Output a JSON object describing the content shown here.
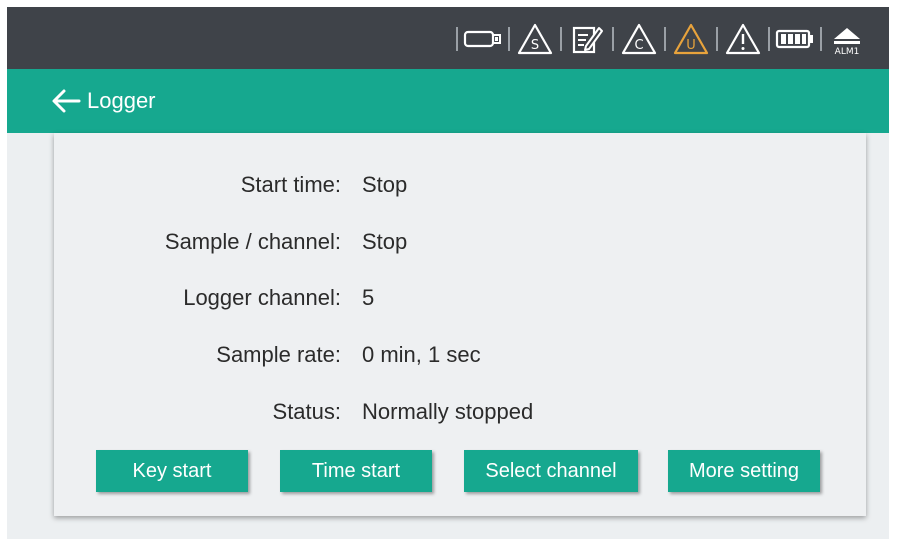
{
  "status_bar": {
    "icons": [
      "usb-icon",
      "s-warning-icon",
      "edit-icon",
      "c-warning-icon",
      "u-warning-icon",
      "alert-warning-icon",
      "battery-icon",
      "alarm-icon"
    ],
    "alarm_label": "ALM1",
    "colors": {
      "background": "#3f4349",
      "icon": "#ffffff",
      "warning_active": "#e8a33c"
    }
  },
  "header": {
    "title": "Logger",
    "color": "#16a88f"
  },
  "info": {
    "rows": [
      {
        "label": "Start time:",
        "value": "Stop"
      },
      {
        "label": "Sample / channel:",
        "value": "Stop"
      },
      {
        "label": "Logger channel:",
        "value": "5"
      },
      {
        "label": "Sample rate:",
        "value": "0 min, 1 sec"
      },
      {
        "label": "Status:",
        "value": "Normally stopped"
      }
    ]
  },
  "buttons": {
    "key_start": "Key start",
    "time_start": "Time start",
    "select_channel": "Select channel",
    "more_setting": "More setting"
  }
}
